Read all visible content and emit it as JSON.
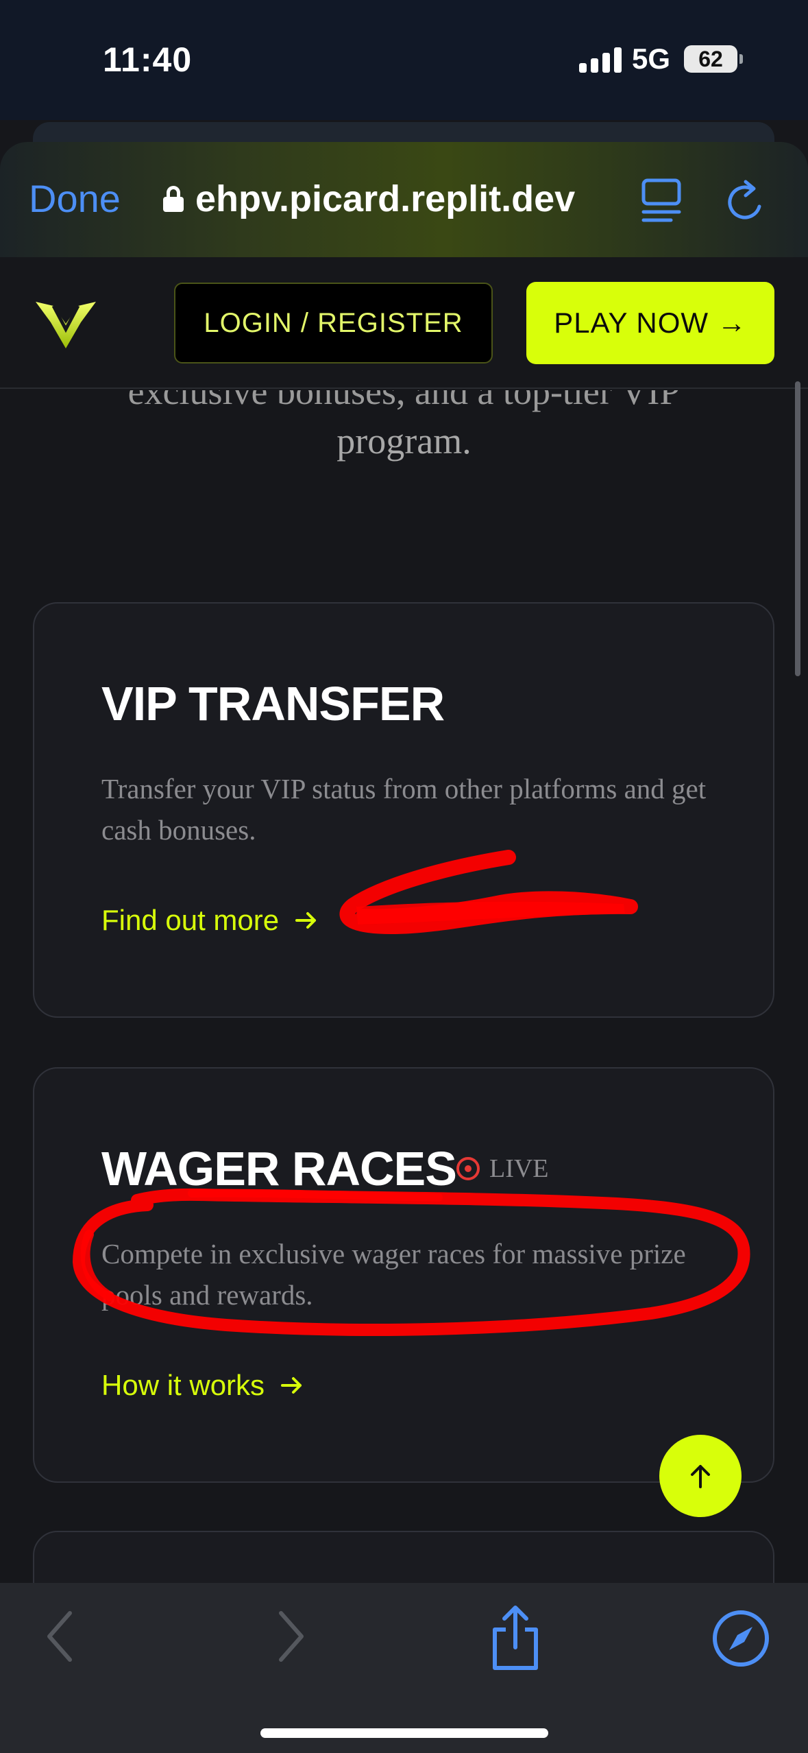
{
  "status_bar": {
    "time": "11:40",
    "network": "5G",
    "battery": "62"
  },
  "browser": {
    "done_label": "Done",
    "url": "ehpv.picard.replit.dev",
    "icons": [
      "lock-icon",
      "reader-icon",
      "reload-icon"
    ]
  },
  "header": {
    "login_label": "LOGIN / REGISTER",
    "play_label": "PLAY NOW →"
  },
  "intro": {
    "cut_line": "exclusive bonuses, and a top-tier VIP",
    "last_line": "program."
  },
  "cards": [
    {
      "title": "VIP TRANSFER",
      "description": "Transfer your VIP status from other platforms and get cash bonuses.",
      "link": "Find out more"
    },
    {
      "title": "WAGER RACES",
      "badge": "LIVE",
      "description": "Compete in exclusive wager races for massive prize pools and rewards.",
      "link": "How it works"
    }
  ],
  "colors": {
    "accent": "#d8ff0a",
    "browser_blue": "#4d8ff5",
    "annotation_red": "#ff0000",
    "live_red": "#e53935",
    "background": "#16171b"
  }
}
